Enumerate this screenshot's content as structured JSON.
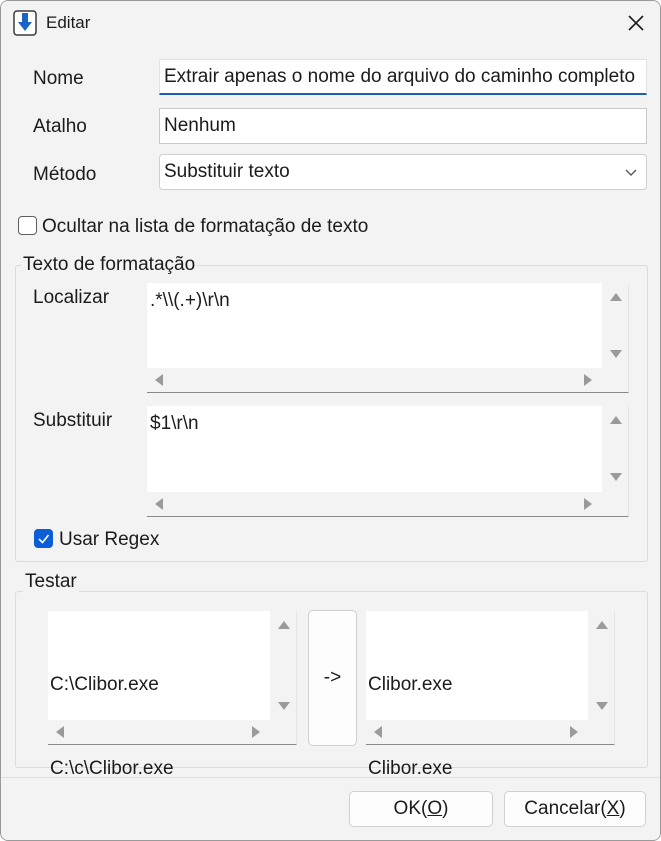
{
  "window": {
    "title": "Editar",
    "app_icon": "download-arrow-icon",
    "close_icon": "close-icon"
  },
  "form": {
    "name_label": "Nome",
    "name_value": "Extrair apenas o nome do arquivo do caminho completo",
    "shortcut_label": "Atalho",
    "shortcut_value": "Nenhum",
    "method_label": "Método",
    "method_value": "Substituir texto",
    "hide_label": "Ocultar na lista de formatação de texto",
    "hide_checked": false
  },
  "format_group": {
    "title": "Texto de formatação",
    "find_label": "Localizar",
    "find_value": ".*\\\\(.+)\\r\\n",
    "replace_label": "Substituir",
    "replace_value": "$1\\r\\n",
    "regex_label": "Usar Regex",
    "regex_checked": true
  },
  "test_group": {
    "title": "Testar",
    "input_lines": [
      "C:\\Clibor.exe",
      "C:\\c\\Clibor.exe"
    ],
    "run_label": "->",
    "output_lines": [
      "Clibor.exe",
      "Clibor.exe"
    ]
  },
  "buttons": {
    "ok_prefix": "OK(",
    "ok_key": "O",
    "ok_suffix": ")",
    "cancel_prefix": "Cancelar(",
    "cancel_key": "X",
    "cancel_suffix": ")"
  },
  "colors": {
    "accent": "#0b5ed7",
    "window_bg": "#f3f3f3"
  }
}
